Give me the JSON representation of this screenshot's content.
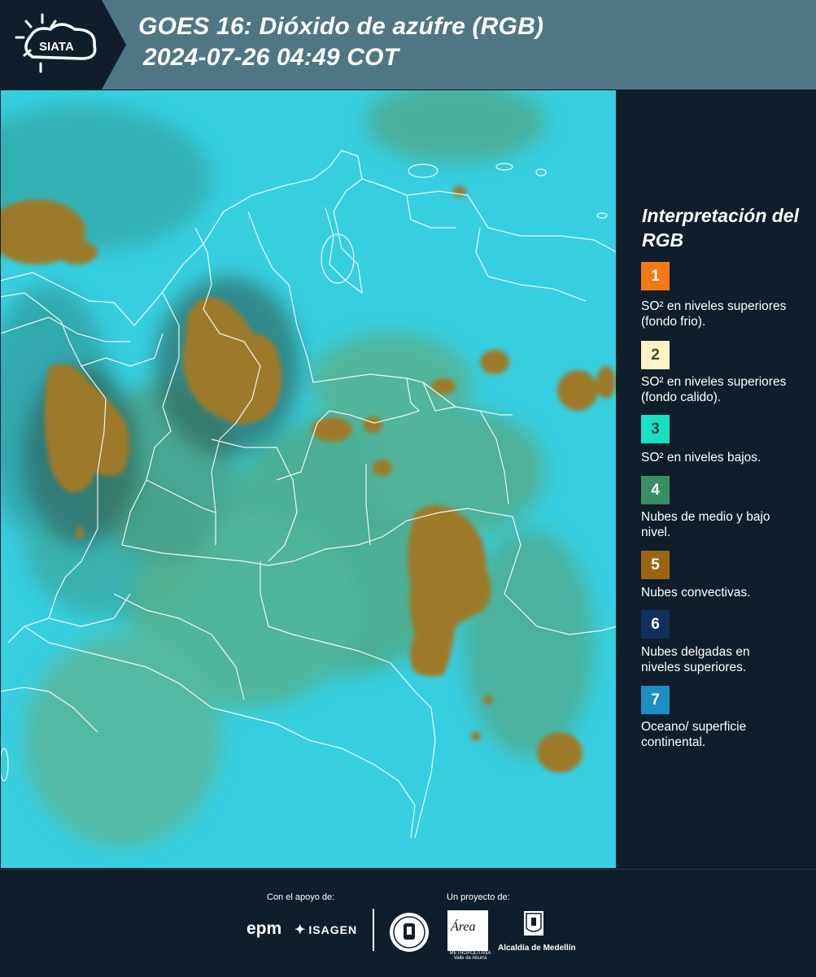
{
  "header": {
    "logo_text": "SIATA",
    "title_line1": "GOES 16: Dióxido de azúfre (RGB)",
    "title_line2": "2024-07-26 04:49 COT"
  },
  "legend": {
    "title": "Interpretación del RGB",
    "items": [
      {
        "number": "1",
        "color": "#f47a14",
        "number_color": "#ffffff",
        "text": "SO² en niveles superiores (fondo frio)."
      },
      {
        "number": "2",
        "color": "#fcf4c4",
        "number_color": "#4a4a2a",
        "text": "SO² en niveles superiores (fondo calido)."
      },
      {
        "number": "3",
        "color": "#18e0c4",
        "number_color": "#0d4d44",
        "text": "SO² en niveles bajos."
      },
      {
        "number": "4",
        "color": "#3a8e64",
        "number_color": "#ffffff",
        "text": "Nubes de medio y bajo nivel."
      },
      {
        "number": "5",
        "color": "#9c6412",
        "number_color": "#ffffff",
        "text": "Nubes convectivas."
      },
      {
        "number": "6",
        "color": "#12305e",
        "number_color": "#ffffff",
        "text": "Nubes delgadas en niveles superiores."
      },
      {
        "number": "7",
        "color": "#1c8ec2",
        "number_color": "#ffffff",
        "text": "Oceano/ superficie continental."
      }
    ]
  },
  "footer": {
    "support_label": "Con el apoyo de:",
    "project_label": "Un proyecto de:",
    "epm_logo": "epm",
    "isagen_logo": "ISAGEN",
    "area_logo": "Área",
    "area_logo_sub": "METROPOLITANA Valle de Aburrá",
    "alcaldia_label": "Alcaldía de Medellín"
  },
  "colors": {
    "header_bg": "#4f7684",
    "panel_bg": "#0f1e2a",
    "map_ocean": "#37cfe0",
    "map_land": "#4fae86",
    "convective_cloud": "#9c7a2c"
  }
}
